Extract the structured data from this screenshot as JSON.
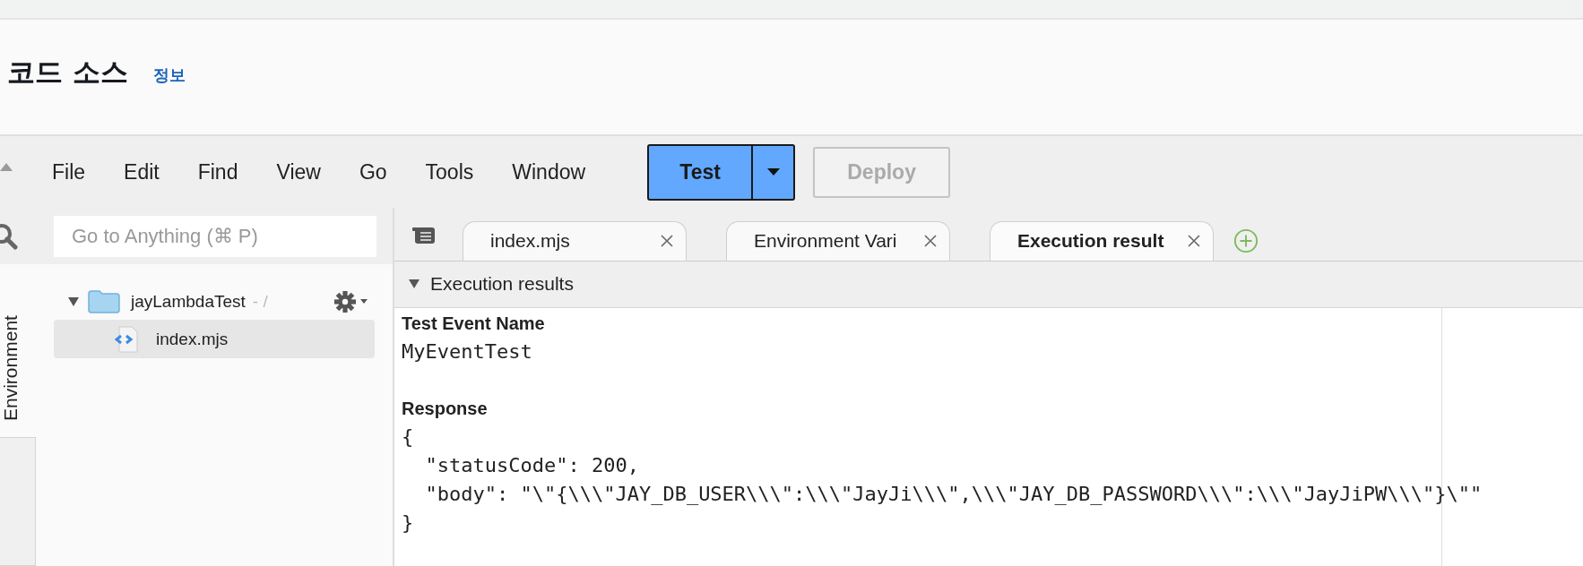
{
  "page": {
    "title": "코드 소스",
    "info_link": "정보"
  },
  "menu": [
    "File",
    "Edit",
    "Find",
    "View",
    "Go",
    "Tools",
    "Window"
  ],
  "actions": [
    {
      "label": "Test",
      "kind": "split",
      "disabled": false
    },
    {
      "label": "Deploy",
      "kind": "plain",
      "disabled": true
    }
  ],
  "sidebar": {
    "search": {
      "placeholder": "Go to Anything (⌘ P)"
    },
    "side_tab": "Environment",
    "tree": [
      {
        "name": "jayLambdaTest",
        "suffix": "- /",
        "expanded": true,
        "selected": false,
        "children": [
          {
            "name": "index.mjs",
            "selected": true
          }
        ]
      }
    ]
  },
  "tabs": [
    {
      "label": "index.mjs",
      "selected": false
    },
    {
      "label": "Environment Vari",
      "selected": false
    },
    {
      "label": "Execution result",
      "selected": true
    }
  ],
  "results": {
    "title": "Execution results",
    "expanded": true,
    "sections": [
      {
        "heading": "Test Event Name",
        "lines": [
          "MyEventTest"
        ]
      },
      {
        "heading": "Response",
        "lines": [
          "{",
          "  \"statusCode\": 200,",
          "  \"body\": \"\\\"{\\\\\\\"JAY_DB_USER\\\\\\\":\\\\\\\"JayJi\\\\\\\",\\\\\\\"JAY_DB_PASSWORD\\\\\\\":\\\\\\\"JayJiPW\\\\\\\"}\\\"\"",
          "}"
        ]
      }
    ]
  }
}
